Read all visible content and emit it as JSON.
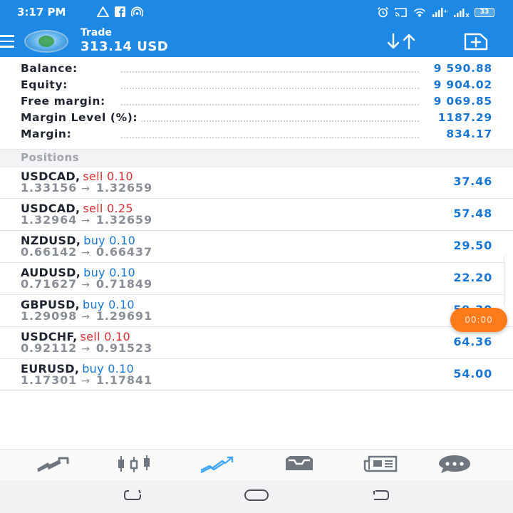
{
  "status_bar": {
    "time": "3:17 PM",
    "battery": "33",
    "left_icons": [
      "warning-icon",
      "facebook-icon",
      "hotspot-icon"
    ],
    "right_icons": [
      "alarm-icon",
      "cast-icon",
      "wifi-icon",
      "signal-icon",
      "signal-bars-icon",
      "battery-icon"
    ]
  },
  "header": {
    "title": "Trade",
    "subtitle": "313.14 USD",
    "icons": [
      "menu-icon",
      "app-logo",
      "sort-icon",
      "new-order-icon"
    ]
  },
  "account": [
    {
      "label": "Balance:",
      "value": "9 590.88"
    },
    {
      "label": "Equity:",
      "value": "9 904.02"
    },
    {
      "label": "Free margin:",
      "value": "9 069.85"
    },
    {
      "label": "Margin Level (%):",
      "value": "1187.29"
    },
    {
      "label": "Margin:",
      "value": "834.17"
    }
  ],
  "positions_header": "Positions",
  "positions": [
    {
      "symbol": "USDCAD,",
      "side": "sell 0.10",
      "side_type": "sell",
      "open": "1.33156",
      "arrow": "→",
      "current": "1.32659",
      "profit": "37.46"
    },
    {
      "symbol": "USDCAD,",
      "side": "sell 0.25",
      "side_type": "sell",
      "open": "1.32964",
      "arrow": "→",
      "current": "1.32659",
      "profit": "57.48"
    },
    {
      "symbol": "NZDUSD,",
      "side": "buy 0.10",
      "side_type": "buy",
      "open": "0.66142",
      "arrow": "→",
      "current": "0.66437",
      "profit": "29.50"
    },
    {
      "symbol": "AUDUSD,",
      "side": "buy 0.10",
      "side_type": "buy",
      "open": "0.71627",
      "arrow": "→",
      "current": "0.71849",
      "profit": "22.20"
    },
    {
      "symbol": "GBPUSD,",
      "side": "buy 0.10",
      "side_type": "buy",
      "open": "1.29098",
      "arrow": "→",
      "current": "1.29691",
      "profit": "59.30"
    },
    {
      "symbol": "USDCHF,",
      "side": "sell 0.10",
      "side_type": "sell",
      "open": "0.92112",
      "arrow": "→",
      "current": "0.91523",
      "profit": "64.36"
    },
    {
      "symbol": "EURUSD,",
      "side": "buy 0.10",
      "side_type": "buy",
      "open": "1.17301",
      "arrow": "→",
      "current": "1.17841",
      "profit": "54.00"
    }
  ],
  "timer": "00:00",
  "bottom_nav": [
    "quotes-icon",
    "chart-icon",
    "trade-icon",
    "history-icon",
    "news-icon",
    "chat-icon"
  ],
  "system_nav": [
    "recents-icon",
    "home-icon",
    "back-icon"
  ],
  "colors": {
    "primary": "#1e88e5",
    "value_blue": "#1976d2",
    "sell_red": "#d32f2f",
    "timer_orange": "#ff7a1a"
  }
}
